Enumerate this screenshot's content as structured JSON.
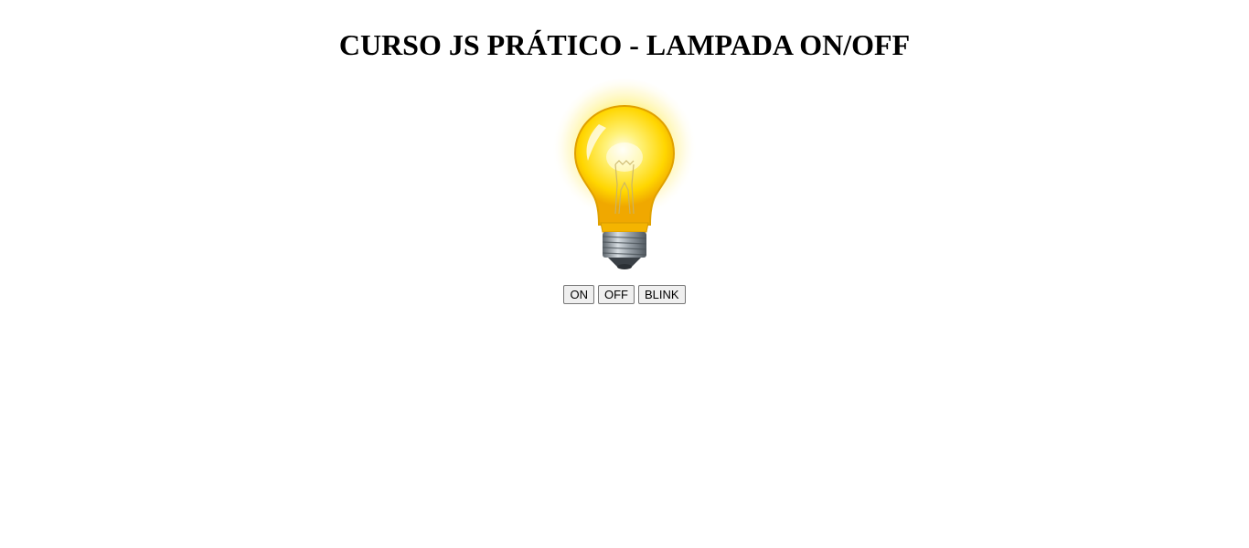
{
  "page": {
    "title": "CURSO JS PRÁTICO - LAMPADA ON/OFF"
  },
  "lamp": {
    "icon": "lightbulb-on-icon",
    "state": "on",
    "colors": {
      "glow": "#fff7a0",
      "glass": "#ffd400",
      "glass_highlight": "#fffbe0",
      "base": "#8a9299"
    }
  },
  "controls": {
    "on_label": "ON",
    "off_label": "OFF",
    "blink_label": "BLINK"
  }
}
